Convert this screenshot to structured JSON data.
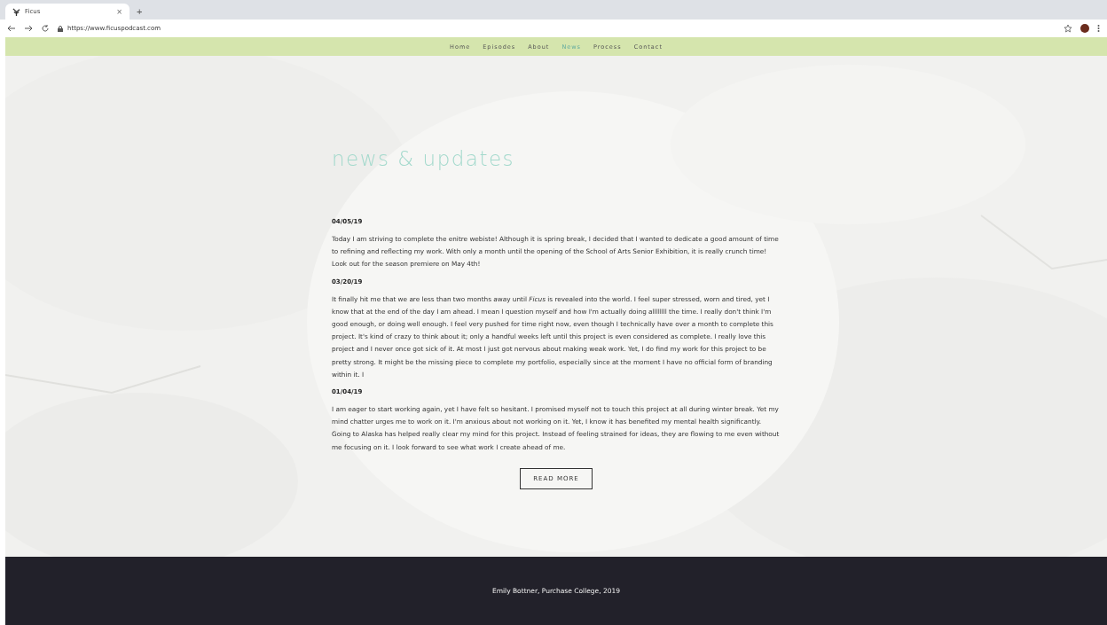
{
  "browser": {
    "tab_title": "Ficus",
    "tab_close": "×",
    "new_tab": "+",
    "url": "https://www.ficuspodcast.com"
  },
  "nav": [
    {
      "label": "Home",
      "selected": false
    },
    {
      "label": "Episodes",
      "selected": false
    },
    {
      "label": "About",
      "selected": false
    },
    {
      "label": "News",
      "selected": true
    },
    {
      "label": "Process",
      "selected": false
    },
    {
      "label": "Contact",
      "selected": false
    }
  ],
  "heading": "news & updates",
  "posts": [
    {
      "date": "04/05/19",
      "body": "Today I am striving to complete the enitre webiste! Although it is spring break, I decided that I wanted to dedicate a good amount of time to refining and reflecting my work. With only a month until the opening of the School of Arts Senior Exhibition, it is really crunch time! Look out for the season premiere on May 4th!"
    },
    {
      "date": "03/20/19",
      "body": "It finally hit me that we are less than two months away until *Ficus* is revealed into the world. I feel super stressed, worn and tired, yet I know that at the end of the day I am ahead. I mean I question myself and how I'm actually doing allllllll the time. I really don't think I'm good enough, or doing well enough. I feel very pushed for time right now, even though I technically have over a month to complete this project. It's kind of crazy to think about it; only a handful weeks left until this project is even considered as complete. I really love this project and I never once got sick of it. At most I just got nervous about making weak work. Yet, I do find my work for this project to be pretty strong. It might be the missing piece to complete my portfolio, especially since at the moment I have no official form of branding within it. I"
    },
    {
      "date": "01/04/19",
      "body": "I am eager to start working again, yet I have felt so hesitant. I promised myself not to touch this project at all during winter break. Yet my mind chatter urges me to work on it. I'm anxious about not working on it. Yet, I know it has benefited my mental health significantly. Going to Alaska has helped really clear my mind for this project. Instead of feeling strained for ideas, they are flowing to me even without me focusing on it. I look forward to see what work I create ahead of me."
    }
  ],
  "read_more": "READ MORE",
  "footer": "Emily Bottner, Purchase College, 2019"
}
